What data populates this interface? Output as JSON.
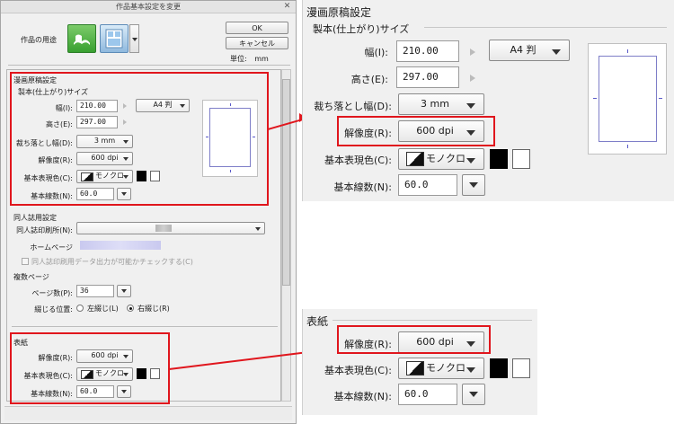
{
  "dialog": {
    "title": "作品基本設定を変更",
    "usage_label": "作品の用途",
    "ok_label": "OK",
    "cancel_label": "キャンセル",
    "unit_label": "単位:",
    "unit_value": "mm"
  },
  "manga_section": {
    "title": "漫画原稿設定",
    "finish_size_title": "製本(仕上がり)サイズ",
    "width_label": "幅(I):",
    "width_value": "210.00",
    "height_label": "高さ(E):",
    "height_value": "297.00",
    "paper_size": "A4 判",
    "bleed_label": "裁ち落とし幅(D):",
    "bleed_value": "3 mm",
    "resolution_label": "解像度(R):",
    "resolution_value": "600 dpi",
    "color_label": "基本表現色(C):",
    "color_value": "モノクロ",
    "lines_label": "基本線数(N):",
    "lines_value": "60.0"
  },
  "doujin_section": {
    "title": "同人誌用設定",
    "printer_label": "同人誌印刷所(N):",
    "homepage_label": "ホームページ",
    "check_label": "同人誌印刷用データ出力が可能かチェックする(C)"
  },
  "multipage_section": {
    "title": "複数ページ",
    "pages_label": "ページ数(P):",
    "pages_value": "36",
    "binding_label": "綴じる位置:",
    "left_binding": "左綴じ(L)",
    "right_binding": "右綴じ(R)"
  },
  "cover_section": {
    "title": "表紙",
    "resolution_label": "解像度(R):",
    "resolution_value": "600 dpi",
    "color_label": "基本表現色(C):",
    "color_value": "モノクロ",
    "lines_label": "基本線数(N):",
    "lines_value": "60.0"
  },
  "zoom_manga": {
    "title": "漫画原稿設定",
    "finish_size_title": "製本(仕上がり)サイズ",
    "width_label": "幅(I):",
    "width_value": "210.00",
    "height_label": "高さ(E):",
    "height_value": "297.00",
    "paper_size": "A4 判",
    "bleed_label": "裁ち落とし幅(D):",
    "bleed_value": "3 mm",
    "resolution_label": "解像度(R):",
    "resolution_value": "600 dpi",
    "color_label": "基本表現色(C):",
    "color_value": "モノクロ",
    "lines_label": "基本線数(N):",
    "lines_value": "60.0"
  },
  "zoom_cover": {
    "title": "表紙",
    "resolution_label": "解像度(R):",
    "resolution_value": "600 dpi",
    "color_label": "基本表現色(C):",
    "color_value": "モノクロ",
    "lines_label": "基本線数(N):",
    "lines_value": "60.0"
  },
  "colors": {
    "highlight": "#e0161d",
    "preview_border": "#7e7ec8"
  },
  "icons": [
    "close-icon",
    "book-icon",
    "comic-icon",
    "link-arrow-icon",
    "dropdown-arrow-icon",
    "black-swatch",
    "white-swatch"
  ]
}
